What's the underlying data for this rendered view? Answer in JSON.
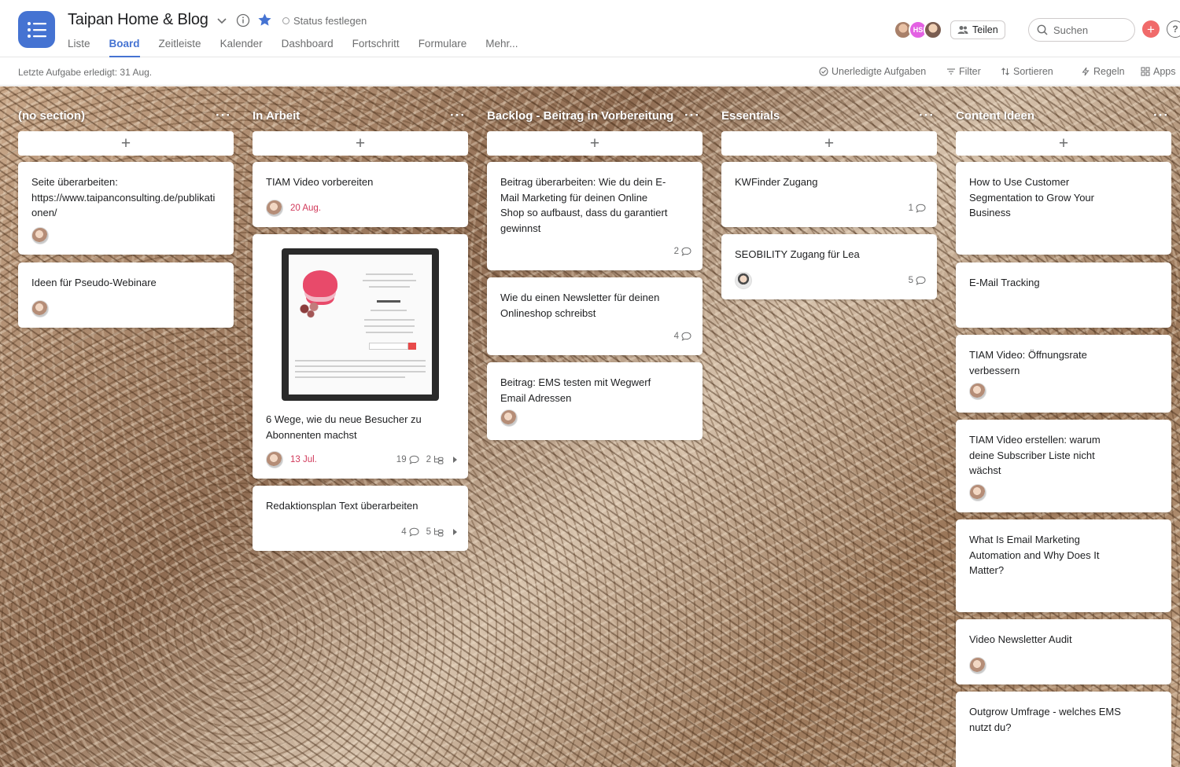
{
  "header": {
    "title": "Taipan Home & Blog",
    "status": "Status festlegen",
    "tabs": [
      "Liste",
      "Board",
      "Zeitleiste",
      "Kalender",
      "Dashboard",
      "Fortschritt",
      "Formulare",
      "Mehr..."
    ],
    "active_tab": "Board",
    "avatar_initials": "HS",
    "share_label": "Teilen",
    "search_placeholder": "Suchen",
    "help_label": "?"
  },
  "subbar": {
    "last_done": "Letzte Aufgabe erledigt: 31 Aug.",
    "incomplete": "Unerledigte Aufgaben",
    "filter": "Filter",
    "sort": "Sortieren",
    "rules": "Regeln",
    "apps": "Apps"
  },
  "columns": [
    {
      "title": "(no section)",
      "cards": [
        {
          "text": "Seite überarbeiten: https://www.taipanconsulting.de/publikationen/"
        },
        {
          "text": "Ideen für Pseudo-Webinare"
        }
      ]
    },
    {
      "title": "In Arbeit",
      "cards": [
        {
          "text": "TIAM Video vorbereiten",
          "due": "20 Aug."
        },
        {
          "text": "6 Wege, wie du neue Besucher zu Abonnenten machst",
          "due": "13 Jul.",
          "comments": "19",
          "subtasks": "2"
        },
        {
          "text": "Redaktionsplan Text überarbeiten",
          "comments": "4",
          "subtasks": "5"
        }
      ]
    },
    {
      "title": "Backlog - Beitrag in Vorbereitung",
      "cards": [
        {
          "text": "Beitrag überarbeiten: Wie du dein E-Mail Marketing für deinen Online Shop so aufbaust, dass du garantiert gewinnst",
          "comments": "2"
        },
        {
          "text": "Wie du einen Newsletter für deinen Onlineshop schreibst",
          "comments": "4"
        },
        {
          "text": "Beitrag: EMS testen mit Wegwerf Email Adressen"
        }
      ]
    },
    {
      "title": "Essentials",
      "cards": [
        {
          "text": "KWFinder Zugang",
          "comments": "1"
        },
        {
          "text": "SEOBILITY Zugang für Lea",
          "comments": "5"
        }
      ]
    },
    {
      "title": "Content Ideen",
      "cards": [
        {
          "text": "How to Use Customer Segmentation to Grow Your Business"
        },
        {
          "text": "E-Mail Tracking"
        },
        {
          "text": "TIAM Video: Öffnungsrate verbessern"
        },
        {
          "text": "TIAM Video erstellen: warum deine Subscriber Liste nicht wächst"
        },
        {
          "text": "What Is Email Marketing Automation and Why Does It Matter?"
        },
        {
          "text": "Video Newsletter Audit"
        },
        {
          "text": "Outgrow Umfrage - welches EMS nutzt du?"
        }
      ]
    }
  ],
  "colors": {
    "accent": "#4573d2",
    "due_red": "#d1395a",
    "add_orange": "#f06a6a"
  }
}
